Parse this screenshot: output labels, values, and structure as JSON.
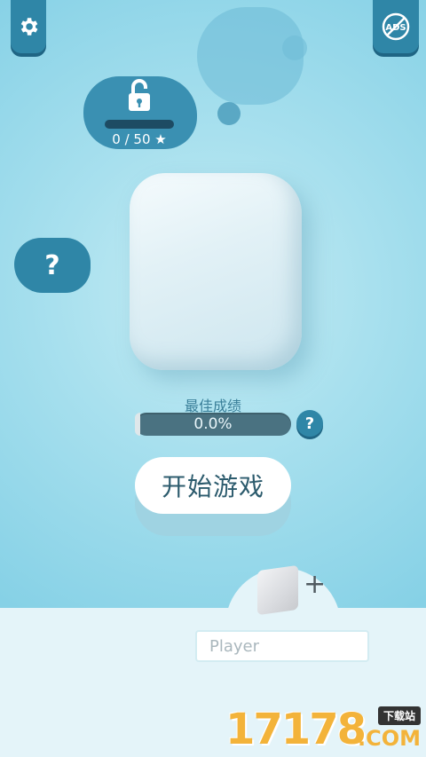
{
  "header": {
    "settings_icon": "gear-icon",
    "no_ads_label": "ADS",
    "no_ads_icon": "no-ads-icon"
  },
  "unlock": {
    "icon": "unlocked-padlock-icon",
    "progress_text": "0 / 50 ★",
    "progress_value": 0
  },
  "hint": {
    "symbol": "?"
  },
  "best_score": {
    "title": "最佳成绩",
    "value_text": "0.0%",
    "help_symbol": "?"
  },
  "start_button": {
    "label": "开始游戏"
  },
  "player": {
    "plus_symbol": "+",
    "input_placeholder": "Player"
  },
  "watermark": {
    "number": "17178",
    "tag": "下载站",
    "suffix": ".COM"
  },
  "colors": {
    "background": "#86d1e6",
    "button_blue": "#2f86a7",
    "progress_track": "#4a7281",
    "panel": "#e4f4f9",
    "watermark_orange": "#f3b33a"
  }
}
